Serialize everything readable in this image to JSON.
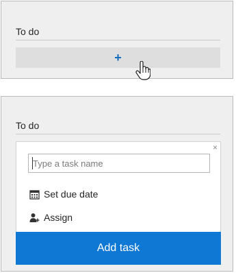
{
  "top_panel": {
    "bucket_title": "To do",
    "add_symbol": "+"
  },
  "bottom_panel": {
    "bucket_title": "To do",
    "close_symbol": "×",
    "task_input": {
      "placeholder": "Type a task name",
      "value": ""
    },
    "options": {
      "due_date_label": "Set due date",
      "assign_label": "Assign"
    },
    "add_task_label": "Add task"
  },
  "colors": {
    "accent": "#0f78d4",
    "panel_bg": "#efefef",
    "add_bar_bg": "#dedede"
  },
  "icons": {
    "add": "plus-icon",
    "cursor": "hand-pointer-icon",
    "close": "close-icon",
    "due_date": "calendar-icon",
    "assign": "person-add-icon"
  }
}
